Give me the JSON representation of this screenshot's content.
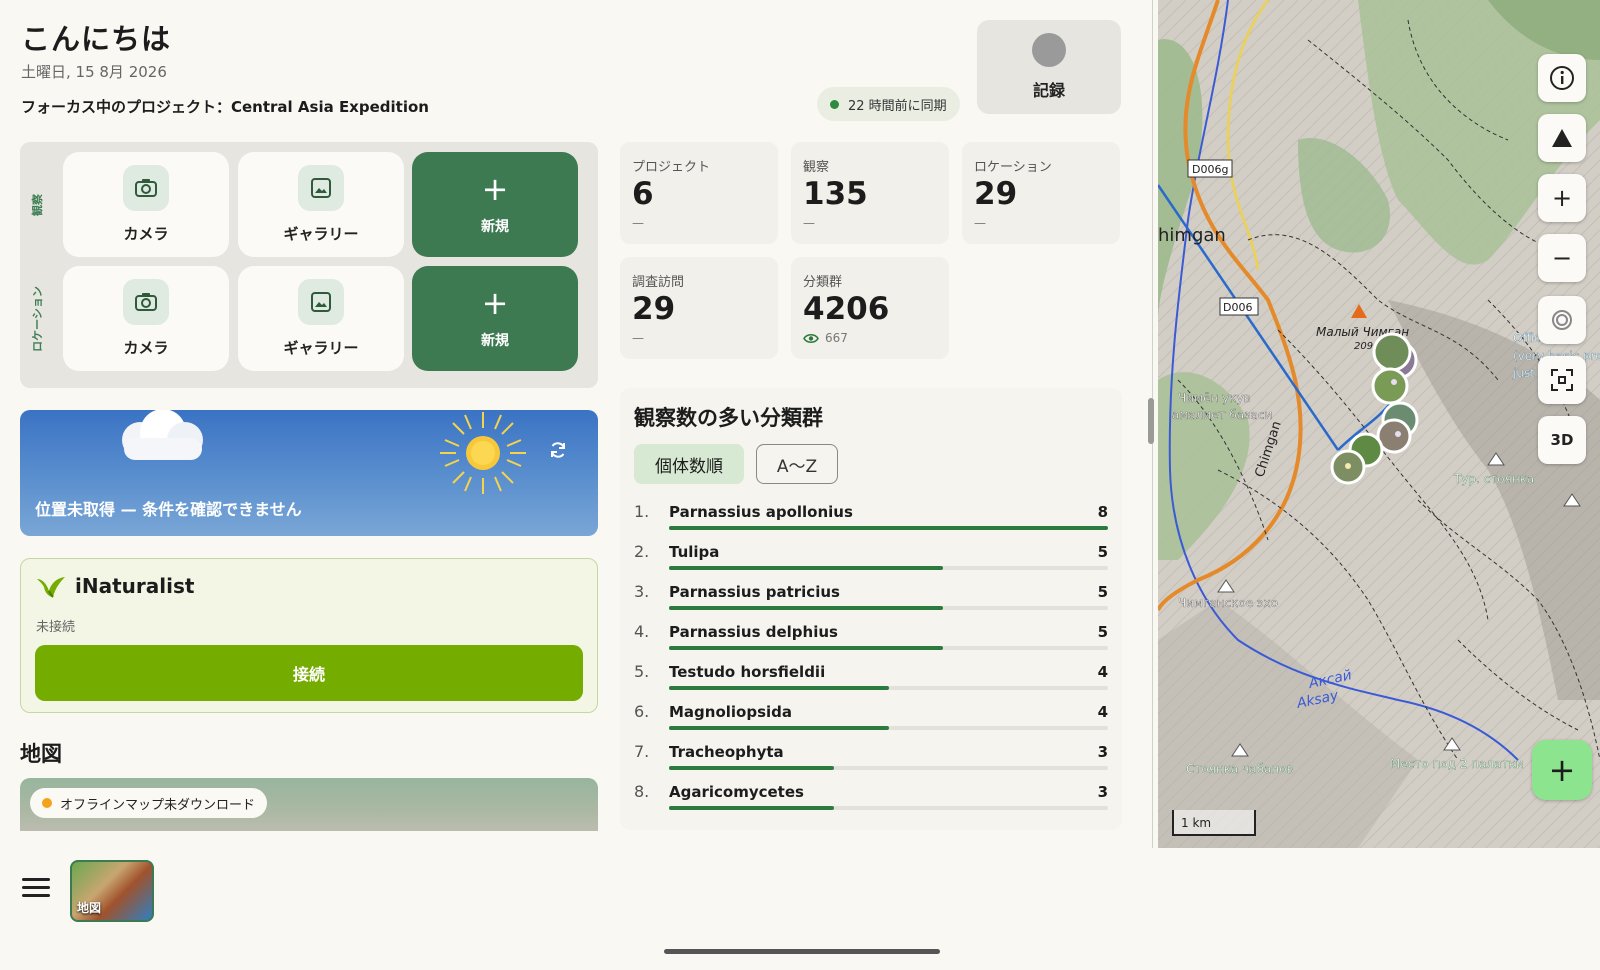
{
  "header": {
    "greeting": "こんにちは",
    "date": "土曜日, 15 8月 2026",
    "focus_project": "フォーカス中のプロジェクト：Central Asia Expedition",
    "sync_status": "22 時間前に同期",
    "record_label": "記録"
  },
  "quick_actions": {
    "observation_label": "観察",
    "location_label": "ロケーション",
    "camera_label": "カメラ",
    "gallery_label": "ギャラリー",
    "new_label": "新規"
  },
  "weather": {
    "message": "位置未取得 — 条件を確認できません"
  },
  "inaturalist": {
    "title": "iNaturalist",
    "status": "未接続",
    "connect_label": "接続"
  },
  "map_section": {
    "title": "地図",
    "offline_status": "オフラインマップ未ダウンロード"
  },
  "stats": [
    {
      "label": "プロジェクト",
      "value": "6",
      "sub": "—"
    },
    {
      "label": "観察",
      "value": "135",
      "sub": "—"
    },
    {
      "label": "ロケーション",
      "value": "29",
      "sub": "—"
    },
    {
      "label": "調査訪問",
      "value": "29",
      "sub": "—"
    },
    {
      "label": "分類群",
      "value": "4206",
      "sub": "667"
    }
  ],
  "top_taxa": {
    "title": "観察数の多い分類群",
    "sort_by_count": "個体数順",
    "sort_az": "A〜Z",
    "items": [
      {
        "rank": "1.",
        "name": "Parnassius apollonius",
        "count": 8
      },
      {
        "rank": "2.",
        "name": "Tulipa",
        "count": 5
      },
      {
        "rank": "3.",
        "name": "Parnassius patricius",
        "count": 5
      },
      {
        "rank": "4.",
        "name": "Parnassius delphius",
        "count": 5
      },
      {
        "rank": "5.",
        "name": "Testudo horsfieldii",
        "count": 4
      },
      {
        "rank": "6.",
        "name": "Magnoliopsida",
        "count": 4
      },
      {
        "rank": "7.",
        "name": "Tracheophyta",
        "count": 3
      },
      {
        "rank": "8.",
        "name": "Agaricomycetes",
        "count": 3
      }
    ],
    "max_count": 8
  },
  "map": {
    "labels": {
      "road1": "D006g",
      "road2": "D006",
      "place1": "himgan",
      "place2": "Малый Чимган",
      "place2_elev": "209",
      "place3": "Чимён укув",
      "place3b": "амалиет базаси",
      "place4": "Чимганское эхо",
      "place5": "Тур. стоянка",
      "river1": "Аксай",
      "river2": "Aksay",
      "place6": "Стоянка чабанов",
      "place7": "Место под 2 палатки",
      "note1": "Offic",
      "note2": "(very basic pro",
      "note3": "just",
      "river_label": "Chimgan"
    },
    "controls": {
      "info_icon": "info-icon",
      "north_icon": "compass-north-icon",
      "zoom_in": "+",
      "zoom_out": "−",
      "locate_icon": "locate-icon",
      "fullscreen_icon": "fullscreen-icon",
      "view3d": "3D"
    },
    "scale": "1 km",
    "add_button": "+"
  },
  "bottom_nav": {
    "map_tab": "地図"
  },
  "colors": {
    "accent_green": "#3d7a52",
    "inat_green": "#74ac00",
    "bar_green": "#2d7a3e",
    "sync_dot": "#2e8b3f",
    "offline_dot": "#f4a21a"
  }
}
